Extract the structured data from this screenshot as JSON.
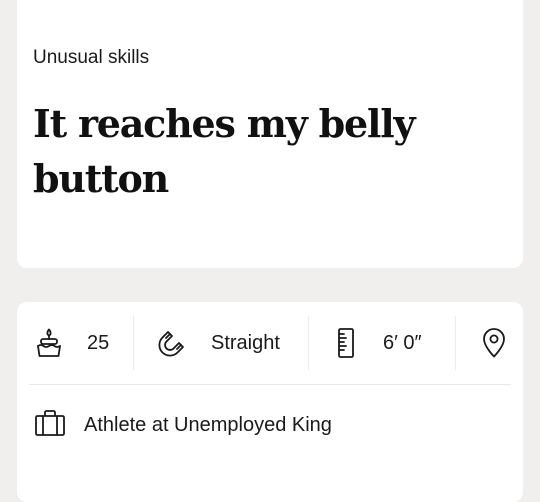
{
  "prompt": {
    "question": "Unusual skills",
    "answer": "It reaches my belly button"
  },
  "vitals": {
    "age": {
      "icon": "cake-icon",
      "value": "25"
    },
    "sexuality": {
      "icon": "magnet-icon",
      "value": "Straight"
    },
    "height": {
      "icon": "ruler-icon",
      "value": "6′ 0″"
    },
    "location": {
      "icon": "location-pin-icon"
    }
  },
  "job": {
    "icon": "briefcase-icon",
    "value": "Athlete at Unemployed King"
  }
}
